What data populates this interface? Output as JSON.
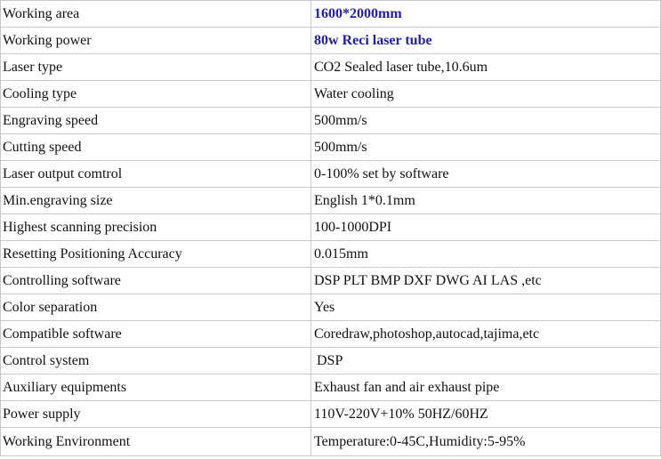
{
  "spec_table": {
    "rows": [
      {
        "label": "Working area",
        "value": "1600*2000mm"
      },
      {
        "label": "Working power",
        "value": "80w Reci laser tube"
      },
      {
        "label": "Laser type",
        "value": "CO2 Sealed laser tube,10.6um"
      },
      {
        "label": "Cooling type",
        "value": "Water cooling"
      },
      {
        "label": "Engraving speed",
        "value": "500mm/s"
      },
      {
        "label": "Cutting speed",
        "value": "500mm/s"
      },
      {
        "label": "Laser output comtrol",
        "value": "0-100% set by software"
      },
      {
        "label": "Min.engraving size",
        "value": "English 1*0.1mm"
      },
      {
        "label": "Highest scanning precision",
        "value": "100-1000DPI"
      },
      {
        "label": "Resetting Positioning Accuracy",
        "value": "0.015mm"
      },
      {
        "label": "Controlling software",
        "value": "DSP PLT BMP DXF DWG AI LAS ,etc"
      },
      {
        "label": "Color separation",
        "value": "Yes"
      },
      {
        "label": "Compatible software",
        "value": "Coredraw,photoshop,autocad,tajima,etc"
      },
      {
        "label": "Control system",
        "value": "DSP"
      },
      {
        "label": "Auxiliary equipments",
        "value": "Exhaust fan and air exhaust pipe"
      },
      {
        "label": "Power supply",
        "value": "110V-220V+10% 50HZ/60HZ"
      },
      {
        "label": "Working Environment",
        "value": "Temperature:0-45C,Humidity:5-95%"
      }
    ]
  },
  "colors": {
    "highlight_text": "#1f1fb0",
    "border": "#c9c9c9",
    "text": "#111111"
  }
}
